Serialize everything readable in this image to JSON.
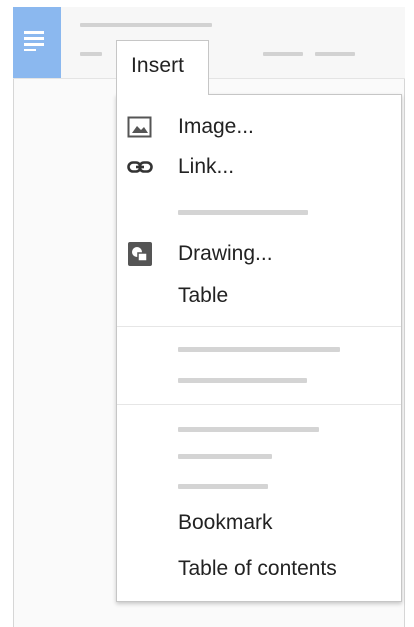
{
  "menu": {
    "title": "Insert",
    "items": [
      {
        "label": "Image...",
        "icon": "image-icon"
      },
      {
        "label": "Link...",
        "icon": "link-icon"
      },
      {
        "label": "Drawing...",
        "icon": "drawing-icon"
      },
      {
        "label": "Table",
        "icon": ""
      },
      {
        "label": "Bookmark",
        "icon": ""
      },
      {
        "label": "Table of contents",
        "icon": ""
      }
    ]
  },
  "colors": {
    "doc_icon_tile": "#8bb8ef",
    "menu_text": "#222222",
    "placeholder_bar": "#d4d4d4"
  }
}
